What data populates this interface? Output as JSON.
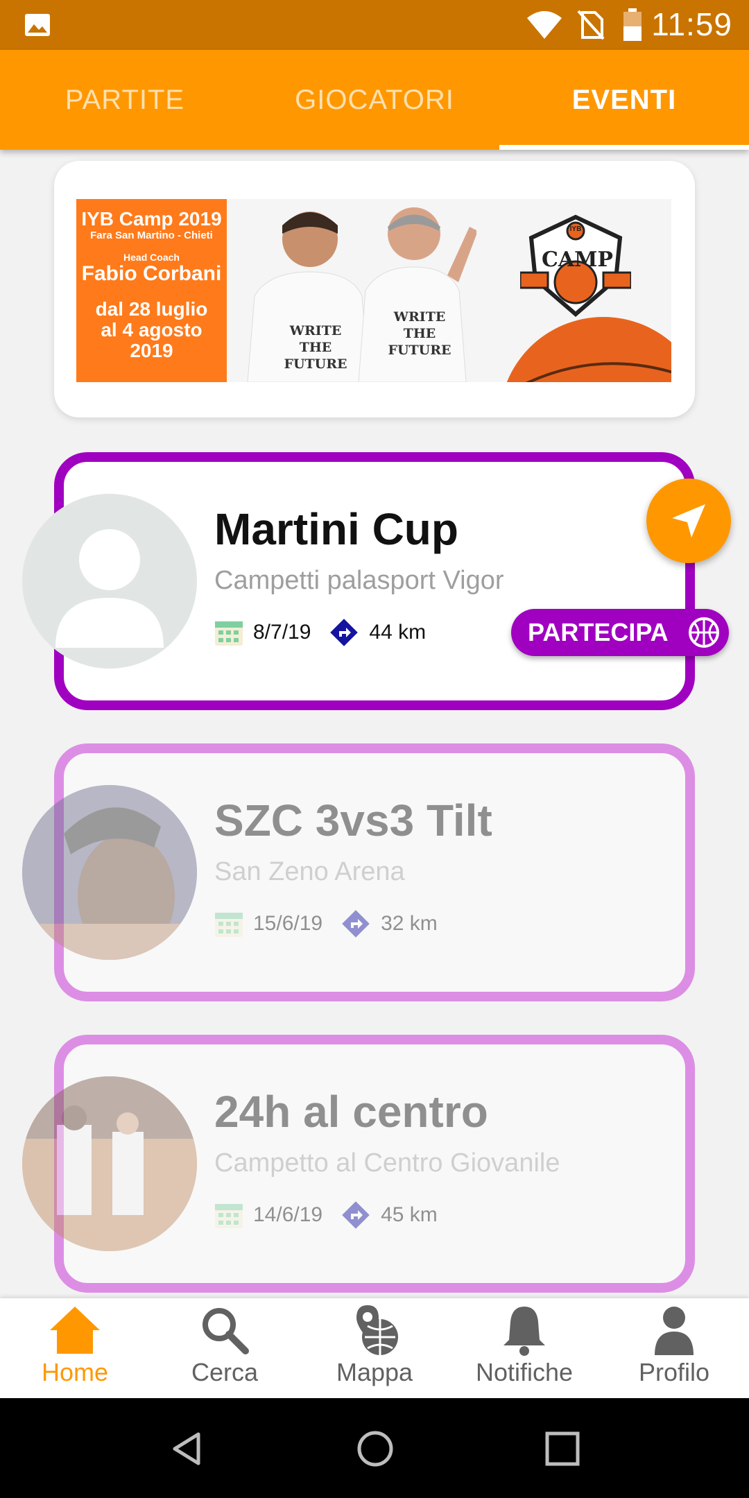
{
  "status_bar": {
    "time": "11:59"
  },
  "tabs": [
    {
      "label": "PARTITE",
      "active": false
    },
    {
      "label": "GIOCATORI",
      "active": false
    },
    {
      "label": "EVENTI",
      "active": true
    }
  ],
  "banner": {
    "line1": "IYB Camp 2019",
    "line2": "Fara San Martino - Chieti",
    "line3": "Head Coach",
    "line4": "Fabio Corbani",
    "line5a": "dal 28 luglio",
    "line5b": "al 4 agosto",
    "line5c": "2019",
    "shirt_left": "WRITE THE FUTURE",
    "shirt_right": "WRITE THE FUTURE",
    "logo_text": "CAMP",
    "logo_small": "IYB"
  },
  "events": [
    {
      "title": "Martini Cup",
      "venue": "Campetti palasport Vigor",
      "date": "8/7/19",
      "distance": "44 km",
      "action": "PARTECIPA"
    },
    {
      "title": "SZC 3vs3 Tilt",
      "venue": "San Zeno Arena",
      "date": "15/6/19",
      "distance": "32 km"
    },
    {
      "title": "24h al centro",
      "venue": "Campetto al Centro Giovanile",
      "date": "14/6/19",
      "distance": "45 km"
    }
  ],
  "bottom_nav": [
    {
      "label": "Home",
      "icon": "home-icon",
      "active": true
    },
    {
      "label": "Cerca",
      "icon": "search-icon",
      "active": false
    },
    {
      "label": "Mappa",
      "icon": "map-globe-icon",
      "active": false
    },
    {
      "label": "Notifiche",
      "icon": "bell-icon",
      "active": false
    },
    {
      "label": "Profilo",
      "icon": "profile-icon",
      "active": false
    }
  ],
  "colors": {
    "accent": "#ff9800",
    "status_bar": "#c97400",
    "event_border": "#a000c0",
    "event_border_dim": "#dc8ee4"
  }
}
